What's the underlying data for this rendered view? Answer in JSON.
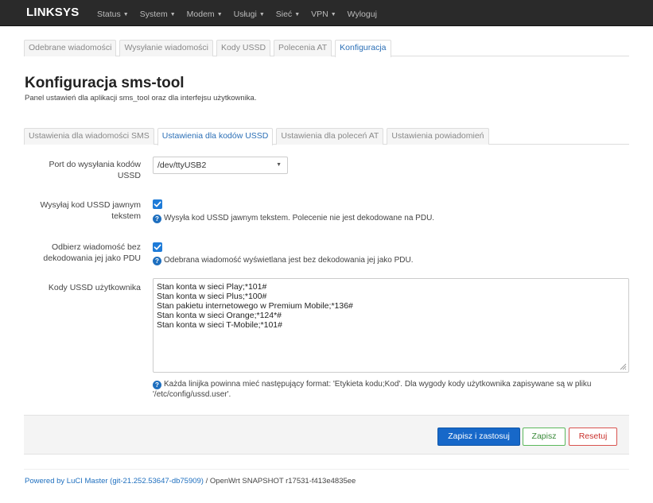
{
  "navbar": {
    "brand": "LINKSYS",
    "items": [
      {
        "label": "Status",
        "dropdown": true
      },
      {
        "label": "System",
        "dropdown": true
      },
      {
        "label": "Modem",
        "dropdown": true
      },
      {
        "label": "Usługi",
        "dropdown": true
      },
      {
        "label": "Sieć",
        "dropdown": true
      },
      {
        "label": "VPN",
        "dropdown": true
      },
      {
        "label": "Wyloguj",
        "dropdown": false
      }
    ]
  },
  "main_tabs": [
    {
      "label": "Odebrane wiadomości",
      "active": false
    },
    {
      "label": "Wysyłanie wiadomości",
      "active": false
    },
    {
      "label": "Kody USSD",
      "active": false
    },
    {
      "label": "Polecenia AT",
      "active": false
    },
    {
      "label": "Konfiguracja",
      "active": true
    }
  ],
  "page": {
    "title": "Konfiguracja sms-tool",
    "description": "Panel ustawień dla aplikacji sms_tool oraz dla interfejsu użytkownika."
  },
  "sub_tabs": [
    {
      "label": "Ustawienia dla wiadomości SMS",
      "active": false
    },
    {
      "label": "Ustawienia dla kodów USSD",
      "active": true
    },
    {
      "label": "Ustawienia dla poleceń AT",
      "active": false
    },
    {
      "label": "Ustawienia powiadomień",
      "active": false
    }
  ],
  "form": {
    "port": {
      "label_line1": "Port do wysyłania kodów",
      "label_line2": "USSD",
      "value": "/dev/ttyUSB2"
    },
    "plaintext": {
      "label_line1": "Wysyłaj kod USSD jawnym",
      "label_line2": "tekstem",
      "checked": true,
      "help": "Wysyła kod USSD jawnym tekstem. Polecenie nie jest dekodowane na PDU."
    },
    "nodecode": {
      "label_line1": "Odbierz wiadomość bez",
      "label_line2": "dekodowania jej jako PDU",
      "checked": true,
      "help": "Odebrana wiadomość wyświetlana jest bez dekodowania jej jako PDU."
    },
    "user_codes": {
      "label": "Kody USSD użytkownika",
      "lines": [
        "Stan konta w sieci Play;*101#",
        "Stan konta w sieci Plus;*100#",
        "Stan pakietu internetowego w Premium Mobile;*136#",
        "Stan konta w sieci Orange;*124*#",
        "Stan konta w sieci T-Mobile;*101#"
      ],
      "help_line1": "Każda linijka powinna mieć następujący format: 'Etykieta kodu;Kod'. Dla wygody kody użytkownika zapisywane są w pliku",
      "help_line2": "'/etc/config/ussd.user'."
    }
  },
  "actions": {
    "apply": "Zapisz i zastosuj",
    "save": "Zapisz",
    "reset": "Resetuj"
  },
  "footer": {
    "link": "Powered by LuCI Master (git-21.252.53647-db75909)",
    "text": " / OpenWrt SNAPSHOT r17531-f413e4835ee"
  },
  "colors": {
    "navbar_bg": "#2a2a2a",
    "accent": "#1768c9",
    "save_green": "#5cb85c",
    "reset_red": "#d9534f"
  }
}
